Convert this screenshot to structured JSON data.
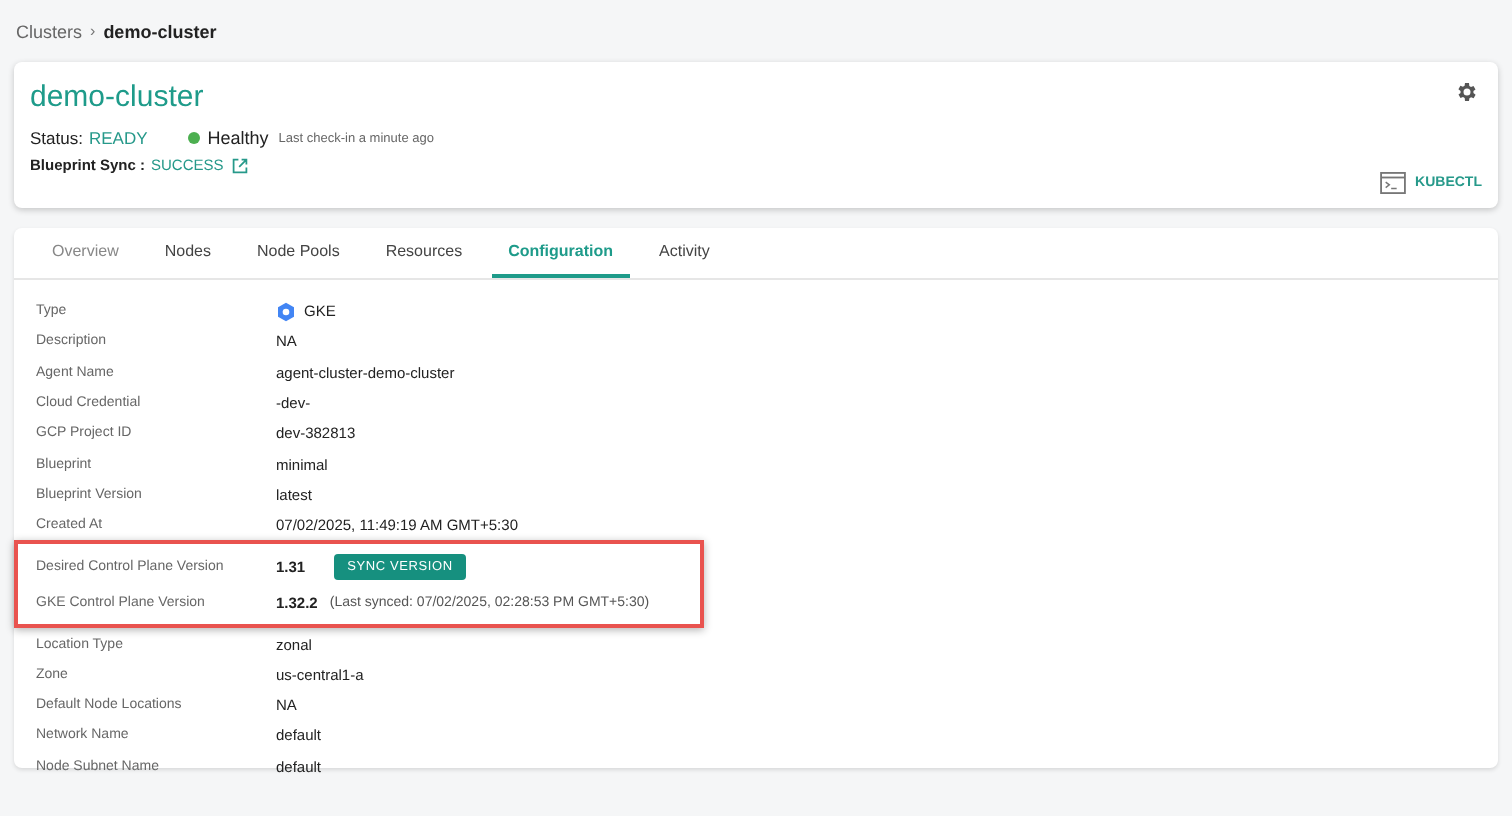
{
  "breadcrumb": [
    "Clusters",
    "demo-cluster"
  ],
  "breadcrumb_separator": "›",
  "header": {
    "title": "demo-cluster",
    "status_label": "Status:",
    "status": "READY",
    "health": "Healthy",
    "checkin": "Last check-in a minute ago",
    "blueprint_label": "Blueprint Sync :",
    "blueprint_status": "SUCCESS",
    "kubectl": "KUBECTL"
  },
  "tabs": [
    {
      "label": "Overview",
      "selected": false
    },
    {
      "label": "Nodes",
      "selected": false
    },
    {
      "label": "Node Pools",
      "selected": false
    },
    {
      "label": "Resources",
      "selected": false
    },
    {
      "label": "Configuration",
      "selected": true
    },
    {
      "label": "Activity",
      "selected": false
    }
  ],
  "rows": [
    {
      "kind": "type",
      "label": "Type",
      "value": "GKE",
      "highlighted": false
    },
    {
      "kind": "text",
      "label": "Description",
      "value": "NA",
      "highlighted": false
    },
    {
      "kind": "text",
      "label": "Agent Name",
      "value": "agent-cluster-demo-cluster",
      "highlighted": false
    },
    {
      "kind": "text",
      "label": "Cloud Credential",
      "value": "-dev-",
      "highlighted": false
    },
    {
      "kind": "text",
      "label": "GCP Project ID",
      "value": "dev-382813",
      "highlighted": false
    },
    {
      "kind": "text",
      "label": "Blueprint",
      "value": "minimal",
      "highlighted": false
    },
    {
      "kind": "text",
      "label": "Blueprint Version",
      "value": "latest",
      "highlighted": false
    },
    {
      "kind": "text",
      "label": "Created At",
      "value": "07/02/2025, 11:49:19 AM GMT+5:30",
      "highlighted": false
    },
    {
      "kind": "action",
      "label": "Desired Control Plane Version",
      "value": "1.31",
      "button": "SYNC VERSION",
      "highlighted": true
    },
    {
      "kind": "note",
      "label": "GKE Control Plane Version",
      "value": "1.32.2",
      "note": "(Last synced: 07/02/2025, 02:28:53 PM GMT+5:30)",
      "highlighted": true
    },
    {
      "kind": "text",
      "label": "Location Type",
      "value": "zonal",
      "highlighted": false
    },
    {
      "kind": "text",
      "label": "Zone",
      "value": "us-central1-a",
      "highlighted": false
    },
    {
      "kind": "text",
      "label": "Default Node Locations",
      "value": "NA",
      "highlighted": false
    },
    {
      "kind": "text",
      "label": "Network Name",
      "value": "default",
      "highlighted": false
    },
    {
      "kind": "text",
      "label": "Node Subnet Name",
      "value": "default",
      "highlighted": false
    }
  ]
}
